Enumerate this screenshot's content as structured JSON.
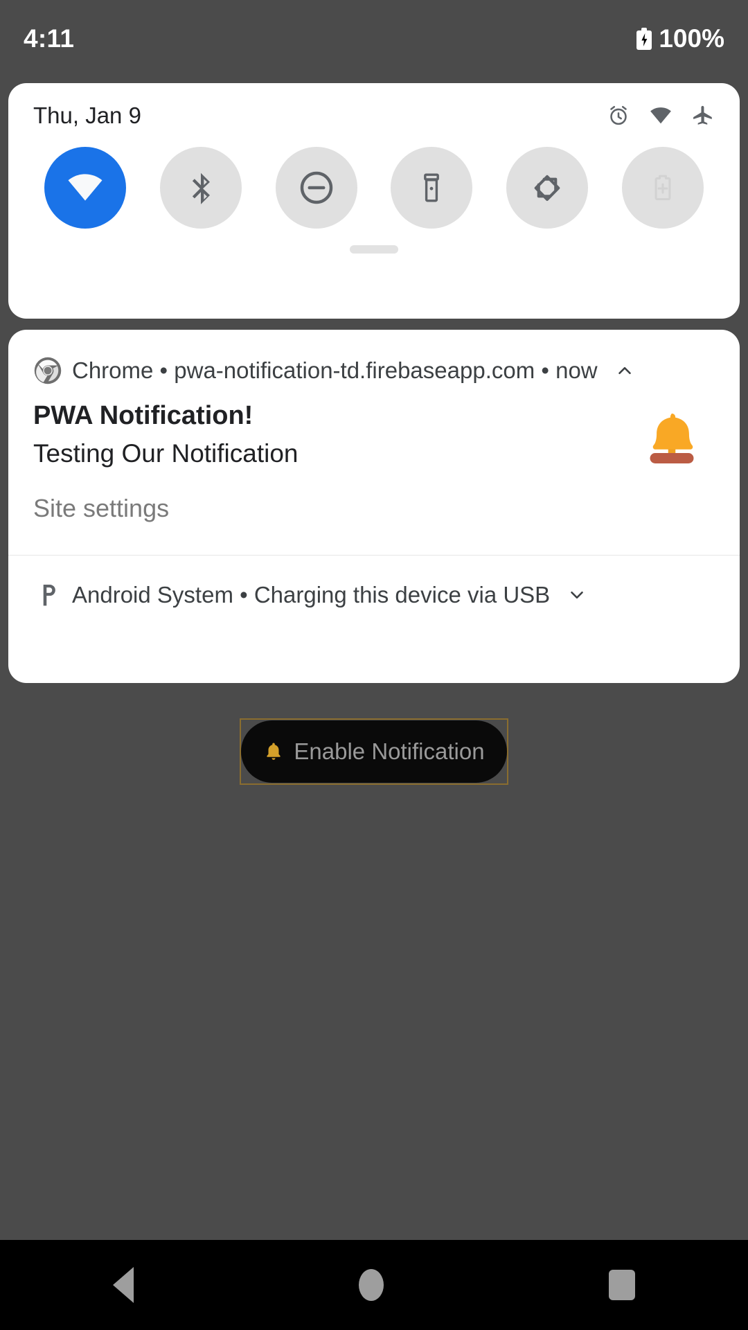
{
  "status_bar": {
    "time": "4:11",
    "battery_percent": "100%",
    "battery_icon": "battery-charging-icon"
  },
  "quick_settings": {
    "date": "Thu, Jan 9",
    "status_icons": [
      {
        "name": "alarm-icon",
        "label": "Alarm set"
      },
      {
        "name": "wifi-icon",
        "label": "Wi-Fi connected"
      },
      {
        "name": "airplane-icon",
        "label": "Airplane mode"
      }
    ],
    "tiles": [
      {
        "name": "wifi-tile",
        "label": "Wi-Fi",
        "active": true
      },
      {
        "name": "bluetooth-tile",
        "label": "Bluetooth",
        "active": false
      },
      {
        "name": "dnd-tile",
        "label": "Do Not Disturb",
        "active": false
      },
      {
        "name": "flashlight-tile",
        "label": "Flashlight",
        "active": false
      },
      {
        "name": "auto-rotate-tile",
        "label": "Auto-rotate",
        "active": false
      },
      {
        "name": "battery-saver-tile",
        "label": "Battery Saver",
        "active": false
      }
    ],
    "handle": "drag-handle",
    "colors": {
      "tile_active": "#1a73e8",
      "tile_inactive": "#e0e0e0",
      "panel": "#ffffff"
    }
  },
  "notifications": [
    {
      "app": "Chrome",
      "source": "pwa-notification-td.firebaseapp.com",
      "time": "now",
      "header_line": "Chrome • pwa-notification-td.firebaseapp.com • now",
      "expand_state": "expanded",
      "chevron": "chevron-up-icon",
      "title": "PWA Notification!",
      "body": "Testing Our Notification",
      "large_icon": "bell-icon",
      "actions": [
        {
          "label": "Site settings",
          "name": "site-settings-action"
        }
      ]
    },
    {
      "app": "Android System",
      "header_line": "Android System • Charging this device via USB",
      "summary": "Charging this device via USB",
      "expand_state": "collapsed",
      "chevron": "chevron-down-icon",
      "app_icon": "android-system-icon"
    }
  ],
  "page": {
    "enable_button": {
      "label": "Enable Notification",
      "icon": "bell-icon",
      "focused": true
    },
    "scrim_color": "#4b4b4b"
  },
  "nav_bar": {
    "buttons": [
      {
        "name": "nav-back-button",
        "label": "Back"
      },
      {
        "name": "nav-home-button",
        "label": "Home"
      },
      {
        "name": "nav-recents-button",
        "label": "Recents"
      }
    ]
  }
}
